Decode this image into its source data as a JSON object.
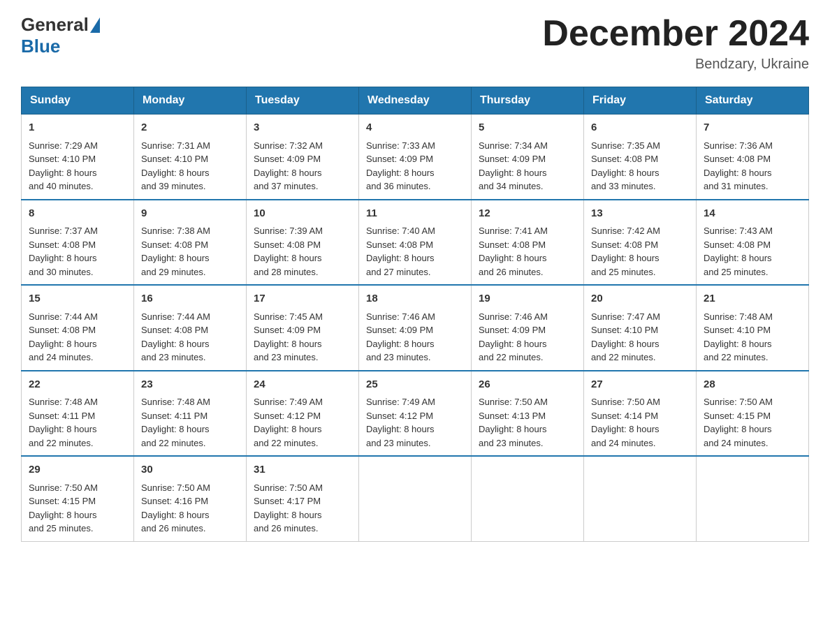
{
  "logo": {
    "text_general": "General",
    "text_blue": "Blue"
  },
  "title": "December 2024",
  "location": "Bendzary, Ukraine",
  "days_of_week": [
    "Sunday",
    "Monday",
    "Tuesday",
    "Wednesday",
    "Thursday",
    "Friday",
    "Saturday"
  ],
  "weeks": [
    [
      {
        "day": "1",
        "sunrise": "7:29 AM",
        "sunset": "4:10 PM",
        "daylight": "8 hours and 40 minutes."
      },
      {
        "day": "2",
        "sunrise": "7:31 AM",
        "sunset": "4:10 PM",
        "daylight": "8 hours and 39 minutes."
      },
      {
        "day": "3",
        "sunrise": "7:32 AM",
        "sunset": "4:09 PM",
        "daylight": "8 hours and 37 minutes."
      },
      {
        "day": "4",
        "sunrise": "7:33 AM",
        "sunset": "4:09 PM",
        "daylight": "8 hours and 36 minutes."
      },
      {
        "day": "5",
        "sunrise": "7:34 AM",
        "sunset": "4:09 PM",
        "daylight": "8 hours and 34 minutes."
      },
      {
        "day": "6",
        "sunrise": "7:35 AM",
        "sunset": "4:08 PM",
        "daylight": "8 hours and 33 minutes."
      },
      {
        "day": "7",
        "sunrise": "7:36 AM",
        "sunset": "4:08 PM",
        "daylight": "8 hours and 31 minutes."
      }
    ],
    [
      {
        "day": "8",
        "sunrise": "7:37 AM",
        "sunset": "4:08 PM",
        "daylight": "8 hours and 30 minutes."
      },
      {
        "day": "9",
        "sunrise": "7:38 AM",
        "sunset": "4:08 PM",
        "daylight": "8 hours and 29 minutes."
      },
      {
        "day": "10",
        "sunrise": "7:39 AM",
        "sunset": "4:08 PM",
        "daylight": "8 hours and 28 minutes."
      },
      {
        "day": "11",
        "sunrise": "7:40 AM",
        "sunset": "4:08 PM",
        "daylight": "8 hours and 27 minutes."
      },
      {
        "day": "12",
        "sunrise": "7:41 AM",
        "sunset": "4:08 PM",
        "daylight": "8 hours and 26 minutes."
      },
      {
        "day": "13",
        "sunrise": "7:42 AM",
        "sunset": "4:08 PM",
        "daylight": "8 hours and 25 minutes."
      },
      {
        "day": "14",
        "sunrise": "7:43 AM",
        "sunset": "4:08 PM",
        "daylight": "8 hours and 25 minutes."
      }
    ],
    [
      {
        "day": "15",
        "sunrise": "7:44 AM",
        "sunset": "4:08 PM",
        "daylight": "8 hours and 24 minutes."
      },
      {
        "day": "16",
        "sunrise": "7:44 AM",
        "sunset": "4:08 PM",
        "daylight": "8 hours and 23 minutes."
      },
      {
        "day": "17",
        "sunrise": "7:45 AM",
        "sunset": "4:09 PM",
        "daylight": "8 hours and 23 minutes."
      },
      {
        "day": "18",
        "sunrise": "7:46 AM",
        "sunset": "4:09 PM",
        "daylight": "8 hours and 23 minutes."
      },
      {
        "day": "19",
        "sunrise": "7:46 AM",
        "sunset": "4:09 PM",
        "daylight": "8 hours and 22 minutes."
      },
      {
        "day": "20",
        "sunrise": "7:47 AM",
        "sunset": "4:10 PM",
        "daylight": "8 hours and 22 minutes."
      },
      {
        "day": "21",
        "sunrise": "7:48 AM",
        "sunset": "4:10 PM",
        "daylight": "8 hours and 22 minutes."
      }
    ],
    [
      {
        "day": "22",
        "sunrise": "7:48 AM",
        "sunset": "4:11 PM",
        "daylight": "8 hours and 22 minutes."
      },
      {
        "day": "23",
        "sunrise": "7:48 AM",
        "sunset": "4:11 PM",
        "daylight": "8 hours and 22 minutes."
      },
      {
        "day": "24",
        "sunrise": "7:49 AM",
        "sunset": "4:12 PM",
        "daylight": "8 hours and 22 minutes."
      },
      {
        "day": "25",
        "sunrise": "7:49 AM",
        "sunset": "4:12 PM",
        "daylight": "8 hours and 23 minutes."
      },
      {
        "day": "26",
        "sunrise": "7:50 AM",
        "sunset": "4:13 PM",
        "daylight": "8 hours and 23 minutes."
      },
      {
        "day": "27",
        "sunrise": "7:50 AM",
        "sunset": "4:14 PM",
        "daylight": "8 hours and 24 minutes."
      },
      {
        "day": "28",
        "sunrise": "7:50 AM",
        "sunset": "4:15 PM",
        "daylight": "8 hours and 24 minutes."
      }
    ],
    [
      {
        "day": "29",
        "sunrise": "7:50 AM",
        "sunset": "4:15 PM",
        "daylight": "8 hours and 25 minutes."
      },
      {
        "day": "30",
        "sunrise": "7:50 AM",
        "sunset": "4:16 PM",
        "daylight": "8 hours and 26 minutes."
      },
      {
        "day": "31",
        "sunrise": "7:50 AM",
        "sunset": "4:17 PM",
        "daylight": "8 hours and 26 minutes."
      },
      null,
      null,
      null,
      null
    ]
  ],
  "labels": {
    "sunrise": "Sunrise:",
    "sunset": "Sunset:",
    "daylight": "Daylight:"
  }
}
